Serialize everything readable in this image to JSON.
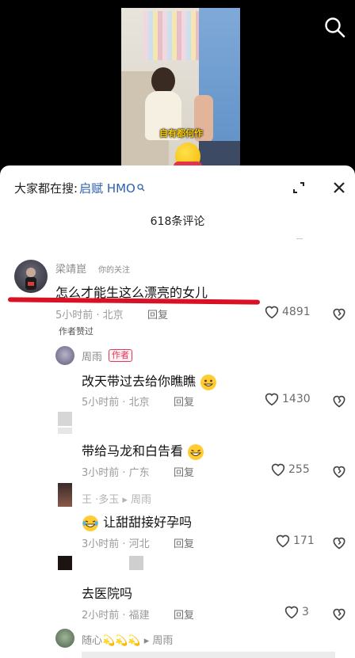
{
  "video": {
    "caption": "自有都何作"
  },
  "search": {
    "prefix": "大家都在搜:",
    "term": "启赋 HMO"
  },
  "comment_count": "618条评论",
  "comments": [
    {
      "username": "梁靖崑",
      "tag": "你的关注",
      "text": "怎么才能生这么漂亮的女儿",
      "meta": "5小时前 · 北京",
      "reply": "回复",
      "likes": "4891",
      "note": "作者赞过"
    },
    {
      "username": "周雨",
      "badge": "作者",
      "text": "改天带过去给你瞧瞧",
      "meta": "5小时前 · 北京",
      "reply": "回复",
      "likes": "1430"
    },
    {
      "text": "带给马龙和白告看",
      "meta": "3小时前 · 广东",
      "reply": "回复",
      "likes": "255"
    },
    {
      "username": "王 ·多玉 ▸ 周雨",
      "text": "让甜甜接好孕吗",
      "meta": "3小时前 · 河北",
      "reply": "回复",
      "likes": "171"
    },
    {
      "text": "去医院吗",
      "meta": "2小时前 · 福建",
      "reply": "回复",
      "likes": "3"
    },
    {
      "username": "随心💫💫💫 ▸ 周雨"
    }
  ]
}
